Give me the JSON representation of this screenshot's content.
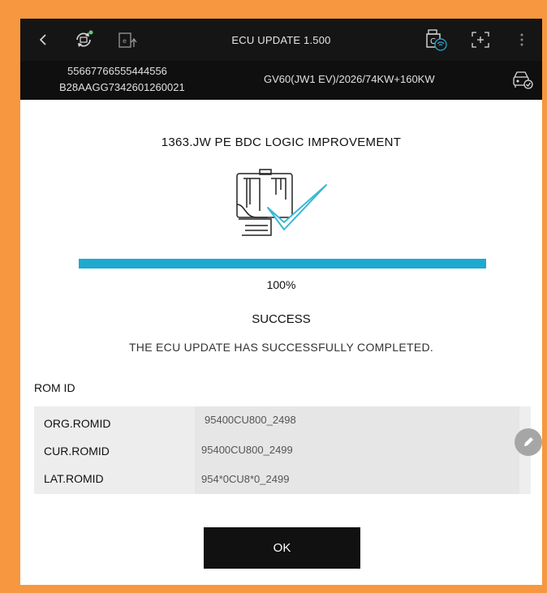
{
  "header": {
    "title": "ECU UPDATE 1.500",
    "icons": [
      "back-icon",
      "ecu-settings-icon",
      "ecu-upload-icon",
      "vci-wifi-icon",
      "screenshot-icon",
      "more-vert-icon"
    ]
  },
  "vehicle": {
    "id_line1": "55667766555444556",
    "id_line2": "B28AAGG7342601260021",
    "model": "GV60(JW1 EV)/2026/74KW+160KW",
    "icon": "car-check-icon"
  },
  "update": {
    "headline": "1363.JW PE BDC LOGIC IMPROVEMENT",
    "progress": 100,
    "percent_label": "100%",
    "status": "SUCCESS",
    "message": "THE ECU UPDATE HAS SUCCESSFULLY COMPLETED."
  },
  "rom": {
    "title": "ROM ID",
    "rows": [
      {
        "label": "ORG.ROMID",
        "value": "95400CU800_2498"
      },
      {
        "label": "CUR.ROMID",
        "value": "95400CU800_2499"
      },
      {
        "label": "LAT.ROMID",
        "value": "954*0CU8*0_2499"
      }
    ]
  },
  "buttons": {
    "ok": "OK"
  },
  "colors": {
    "accent": "#1ea9cf",
    "topbar": "#151515",
    "border": "#f7973f",
    "success_check": "#3bb8d6"
  }
}
